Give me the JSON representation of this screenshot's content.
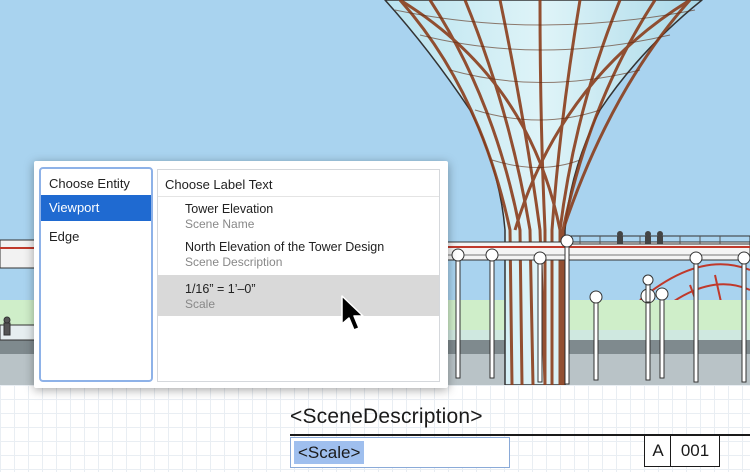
{
  "dialog": {
    "entity_header": "Choose Entity",
    "entities": [
      "Viewport",
      "Edge"
    ],
    "selected_entity": "Viewport",
    "label_header": "Choose Label Text",
    "options": [
      {
        "value": "Tower Elevation",
        "kind": "Scene Name"
      },
      {
        "value": "North Elevation of the Tower Design",
        "kind": "Scene Description"
      },
      {
        "value": "1/16” = 1’–0”",
        "kind": "Scale"
      }
    ],
    "highlighted_option": 2
  },
  "titleblock": {
    "scene_description_token": "<SceneDescription>",
    "scale_token": "<Scale>",
    "sheet_letter": "A",
    "sheet_number": "001"
  },
  "colors": {
    "sky": "#a9d3ef",
    "selection": "#1f6ad1",
    "token_highlight": "#9fbfee",
    "tower_timber": "#8b3e1c"
  },
  "icons": [
    "mouse-pointer-icon"
  ]
}
